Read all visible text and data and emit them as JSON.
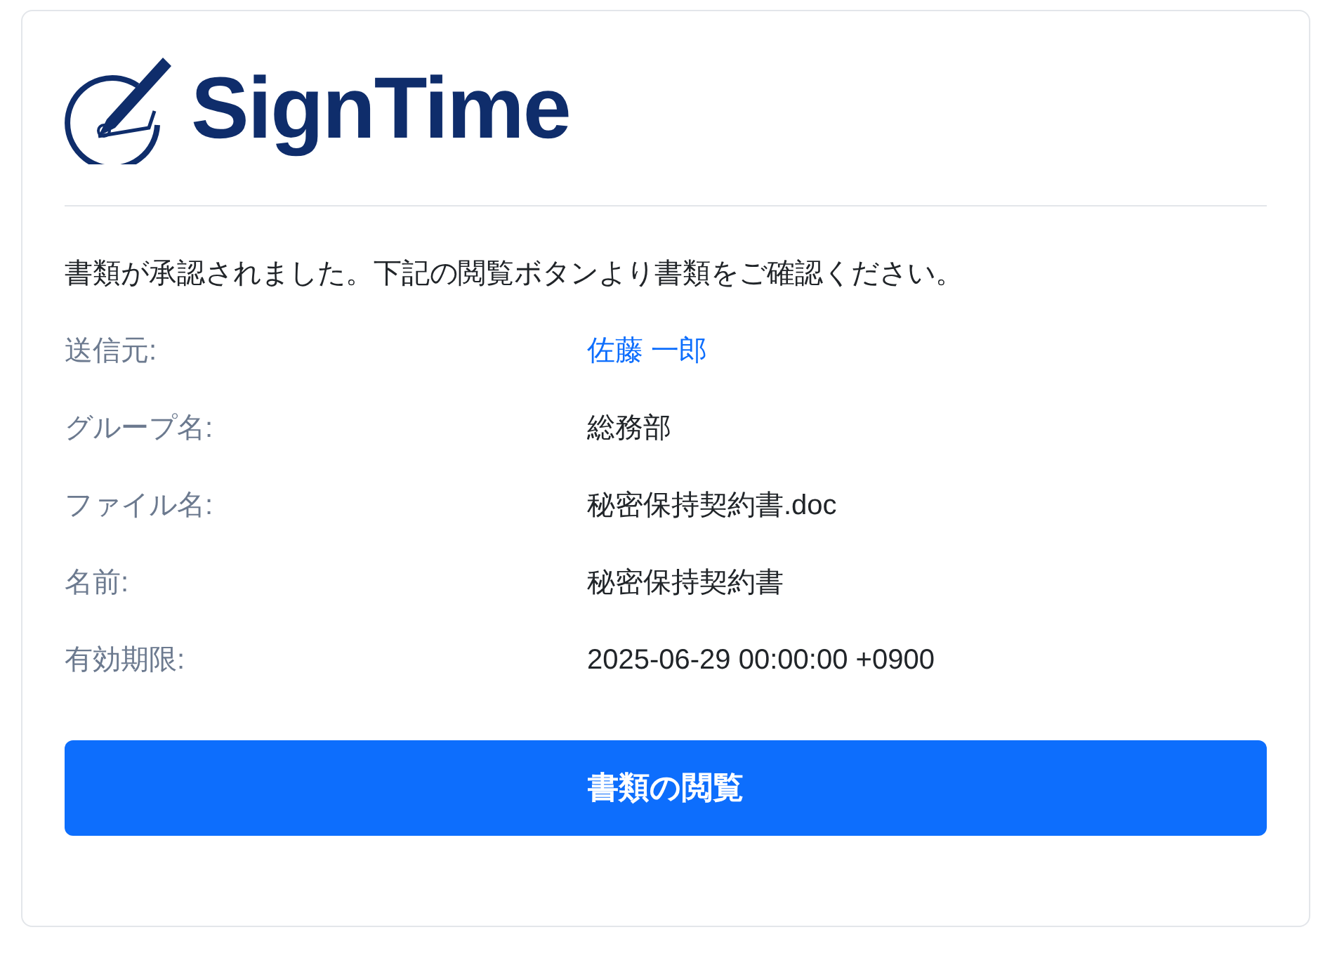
{
  "logo": {
    "text": "SignTime"
  },
  "message": "書類が承認されました。下記の閲覧ボタンより書類をご確認ください。",
  "details": [
    {
      "label": "送信元:",
      "value": "佐藤 一郎",
      "kind": "link"
    },
    {
      "label": "グループ名:",
      "value": "総務部",
      "kind": "text"
    },
    {
      "label": "ファイル名:",
      "value": "秘密保持契約書.doc",
      "kind": "text"
    },
    {
      "label": "名前:",
      "value": "秘密保持契約書",
      "kind": "text"
    },
    {
      "label": "有効期限:",
      "value": "2025-06-29 00:00:00 +0900",
      "kind": "text"
    }
  ],
  "button": {
    "label": "書類の閲覧"
  }
}
